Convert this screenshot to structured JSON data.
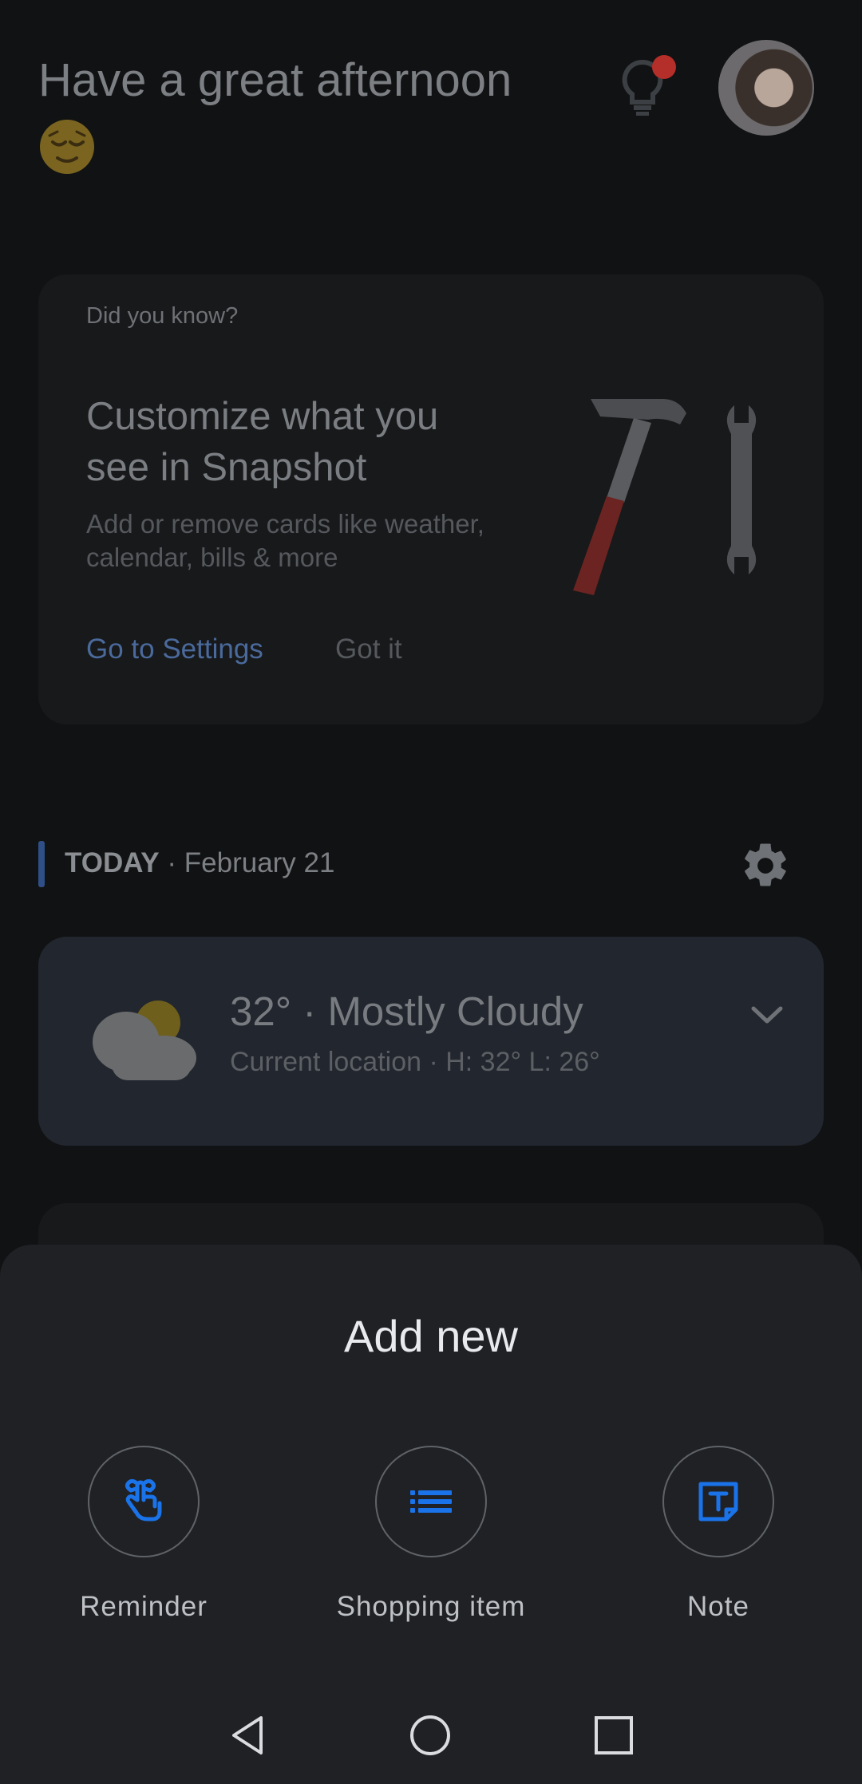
{
  "header": {
    "greeting": "Have a great afternoon",
    "emoji": "relieved-face"
  },
  "tip_card": {
    "eyebrow": "Did you know?",
    "title": "Customize what you see in Snapshot",
    "body": "Add or remove cards like weather, calendar, bills & more",
    "primary_action": "Go to Settings",
    "secondary_action": "Got it"
  },
  "today": {
    "label": "TODAY",
    "date": " · February 21"
  },
  "weather": {
    "summary": "32° · Mostly Cloudy",
    "details": "Current location · H: 32° L: 26°"
  },
  "sheet": {
    "title": "Add new",
    "actions": [
      {
        "label": "Reminder",
        "icon": "reminder-hand-icon"
      },
      {
        "label": "Shopping item",
        "icon": "list-icon"
      },
      {
        "label": "Note",
        "icon": "note-icon"
      }
    ]
  },
  "colors": {
    "accent": "#1a73e8",
    "sheet_bg": "#202124",
    "page_bg": "#111213"
  }
}
